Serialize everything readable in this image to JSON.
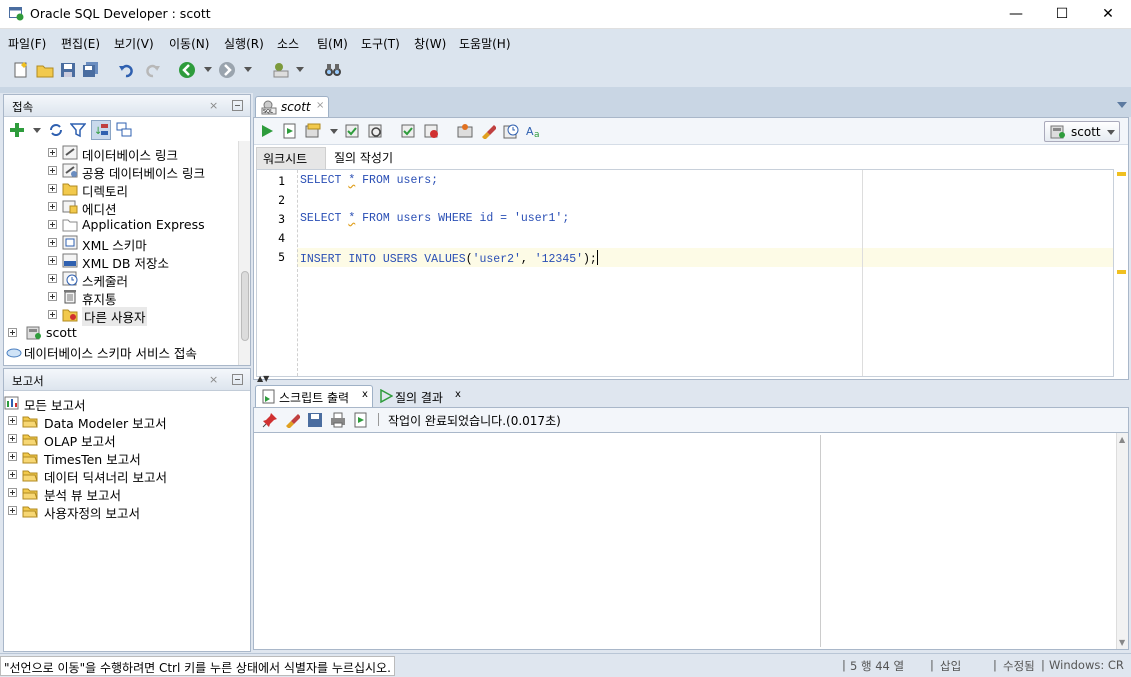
{
  "window": {
    "title": "Oracle SQL Developer : scott",
    "minimize": "—",
    "maximize": "☐",
    "close": "✕"
  },
  "menu": [
    "파일(F)",
    "편집(E)",
    "보기(V)",
    "이동(N)",
    "실행(R)",
    "소스",
    "팀(M)",
    "도구(T)",
    "창(W)",
    "도움말(H)"
  ],
  "connections": {
    "title": "접속",
    "items": [
      {
        "label": "데이터베이스 링크",
        "icon": "db-link-icon"
      },
      {
        "label": "공용 데이터베이스 링크",
        "icon": "public-db-link-icon"
      },
      {
        "label": "디렉토리",
        "icon": "directory-icon"
      },
      {
        "label": "에디션",
        "icon": "edition-icon"
      },
      {
        "label": "Application Express",
        "icon": "folder-icon"
      },
      {
        "label": "XML 스키마",
        "icon": "xml-schema-icon"
      },
      {
        "label": "XML DB 저장소",
        "icon": "xml-db-icon"
      },
      {
        "label": "스케줄러",
        "icon": "scheduler-icon"
      },
      {
        "label": "휴지통",
        "icon": "recycle-bin-icon"
      },
      {
        "label": "다른 사용자",
        "icon": "other-users-icon"
      }
    ],
    "scott": "scott",
    "cloud": "데이터베이스 스키마 서비스 접속"
  },
  "reports": {
    "title": "보고서",
    "root": "모든 보고서",
    "items": [
      "Data Modeler 보고서",
      "OLAP 보고서",
      "TimesTen 보고서",
      "데이터 딕셔너리 보고서",
      "분석 뷰 보고서",
      "사용자정의 보고서"
    ]
  },
  "editor": {
    "tab": "scott",
    "tab_close": "×",
    "connection": "scott",
    "subtabs": [
      "워크시트",
      "질의 작성기"
    ],
    "line_numbers": [
      "1",
      "2",
      "3",
      "4",
      "5"
    ],
    "code": {
      "l1": [
        "SELECT",
        " ",
        "*",
        " ",
        "FROM",
        " users;"
      ],
      "l3": [
        "SELECT",
        " ",
        "*",
        " ",
        "FROM",
        " users ",
        "WHERE",
        " id = ",
        "'user1'",
        ";"
      ],
      "l5": [
        "INSERT",
        " ",
        "INTO",
        " ",
        "USERS",
        " ",
        "VALUES",
        "(",
        "'user2'",
        ", ",
        "'12345'",
        ");"
      ]
    }
  },
  "output": {
    "tabs": [
      "스크립트 출력",
      "질의 결과"
    ],
    "tab_close": "x",
    "status": "작업이 완료되었습니다.(0.017초)"
  },
  "statusbar": {
    "message": "\"선언으로 이동\"을 수행하려면 Ctrl 키를 누른 상태에서 식별자를 누르십시오.",
    "position": "5 행 44 열",
    "mode": "삽입",
    "modified": "수정됨",
    "platform": "Windows: CR"
  }
}
